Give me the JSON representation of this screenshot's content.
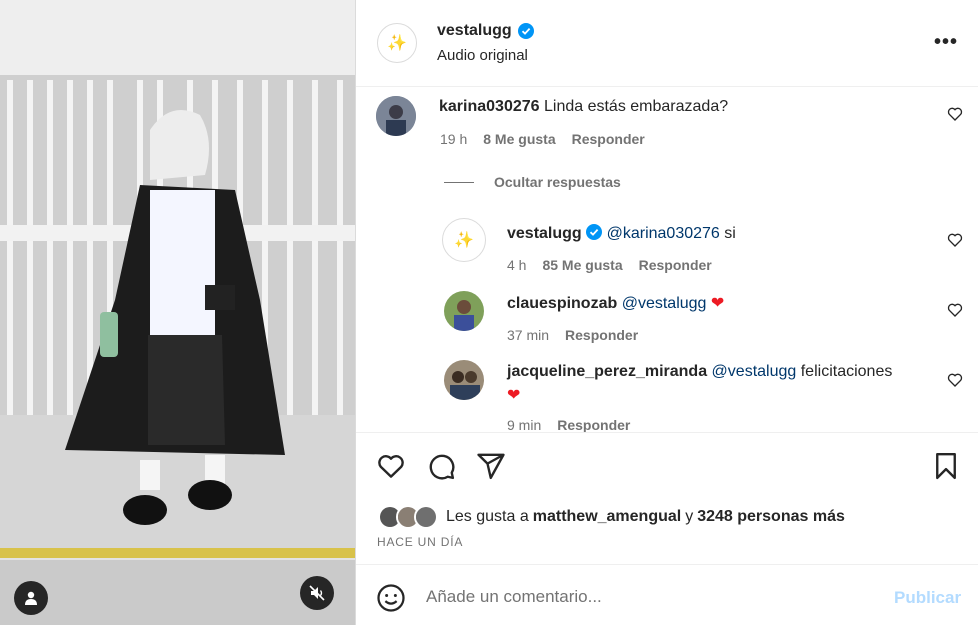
{
  "post": {
    "username": "vestalugg",
    "subtitle": "Audio original",
    "more_icon": "more-horizontal-icon"
  },
  "comments": [
    {
      "username": "karina030276",
      "text": "Linda estás embarazada?",
      "time": "19 h",
      "likes": "8 Me gusta",
      "reply": "Responder"
    }
  ],
  "hide_replies": "Ocultar respuestas",
  "replies": [
    {
      "username": "vestalugg",
      "mention": "@karina030276",
      "text": " si",
      "time": "4 h",
      "likes": "85 Me gusta",
      "reply": "Responder"
    },
    {
      "username": "clauespinozab",
      "mention": "@vestalugg",
      "text": "",
      "emoji": "❤",
      "time": "37 min",
      "reply": "Responder"
    },
    {
      "username": "jacqueline_perez_miranda",
      "mention": "@vestalugg",
      "text": "felicitaciones",
      "emoji": "❤",
      "time": "9 min",
      "reply": "Responder"
    }
  ],
  "likes_summary": {
    "prefix": "Les gusta a ",
    "user": "matthew_amengual",
    "mid": " y ",
    "others": "3248 personas más"
  },
  "date": "Hace un día",
  "composer": {
    "placeholder": "Añade un comentario...",
    "publish": "Publicar"
  },
  "colors": {
    "verified": "#0095f6",
    "heart": "#ed1b24",
    "publish_disabled": "#b3dbff",
    "mention": "#00376b"
  }
}
